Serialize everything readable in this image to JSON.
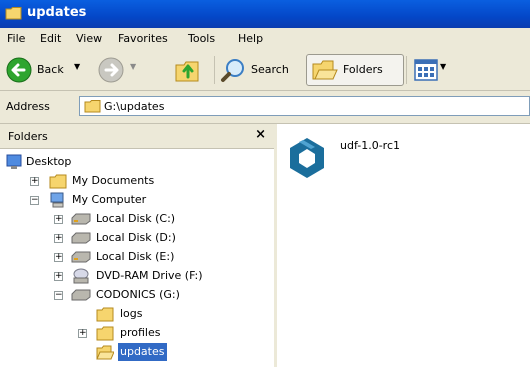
{
  "window": {
    "title": "updates"
  },
  "menu": {
    "file": "File",
    "edit": "Edit",
    "view": "View",
    "favorites": "Favorites",
    "tools": "Tools",
    "help": "Help"
  },
  "toolbar": {
    "back_label": "Back",
    "search_label": "Search",
    "folders_label": "Folders"
  },
  "address": {
    "label": "Address",
    "value": "G:\\updates"
  },
  "folders_pane": {
    "header": "Folders",
    "close": "×",
    "tree": [
      {
        "label": "Desktop"
      },
      {
        "label": "My Documents",
        "expander": "+"
      },
      {
        "label": "My Computer",
        "expander": "−"
      },
      {
        "label": "Local Disk (C:)",
        "expander": "+"
      },
      {
        "label": "Local Disk (D:)",
        "expander": "+"
      },
      {
        "label": "Local Disk (E:)",
        "expander": "+"
      },
      {
        "label": "DVD-RAM Drive (F:)",
        "expander": "+"
      },
      {
        "label": "CODONICS (G:)",
        "expander": "−"
      },
      {
        "label": "logs"
      },
      {
        "label": "profiles",
        "expander": "+"
      },
      {
        "label": "updates",
        "selected": true
      }
    ]
  },
  "content": {
    "items": [
      {
        "name": "udf-1.0-rc1",
        "icon": "package-icon"
      }
    ]
  },
  "colors": {
    "titlebar": "#0447c8",
    "chrome": "#ece9d8",
    "selection": "#316ac5",
    "folder": "#f6d56e",
    "back_button": "#2fa52f",
    "package_icon": "#1b6e9c"
  }
}
